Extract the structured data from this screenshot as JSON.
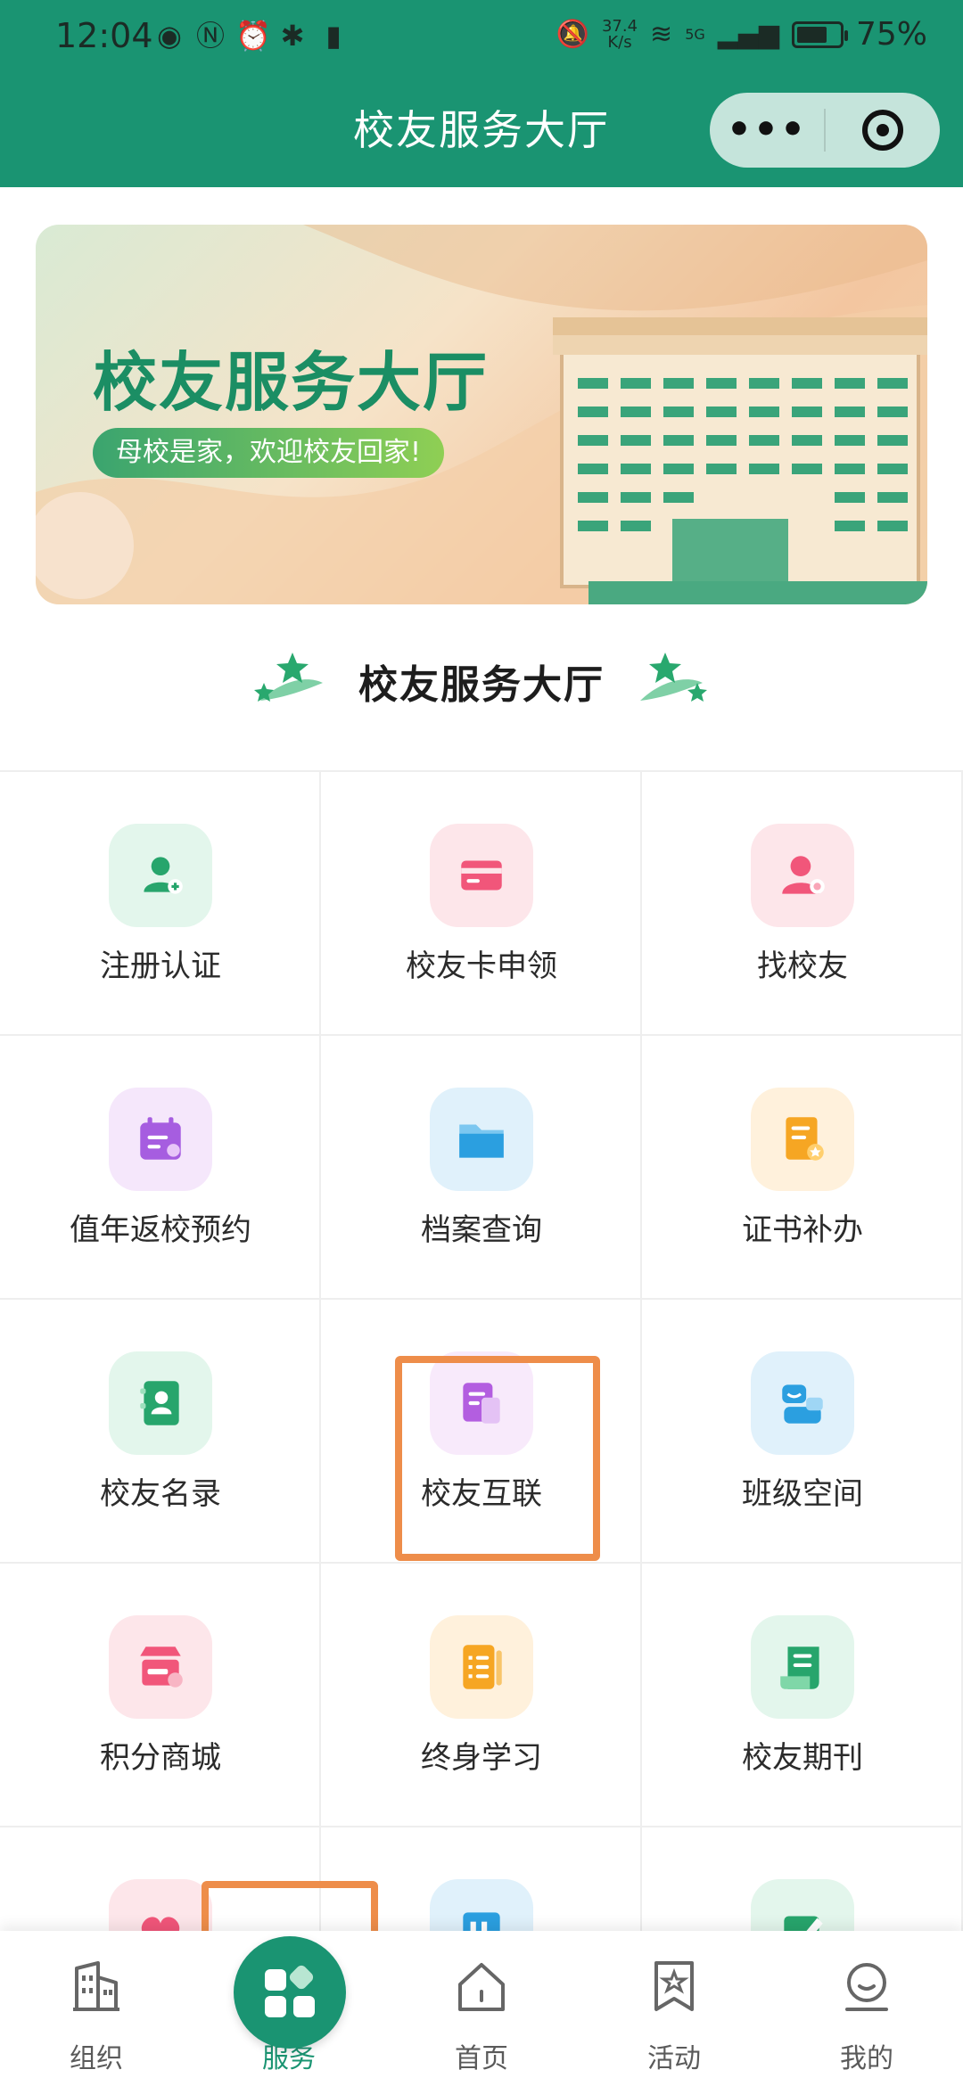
{
  "status_bar": {
    "time": "12:04",
    "net_speed_value": "37.4",
    "net_speed_unit": "K/s",
    "network": "5G",
    "battery_percent": "75%",
    "battery_level": 0.75
  },
  "nav": {
    "title": "校友服务大厅",
    "more_label": "•••"
  },
  "banner": {
    "title": "校友服务大厅",
    "slogan": "母校是家，欢迎校友回家!"
  },
  "section": {
    "title": "校友服务大厅"
  },
  "services": [
    {
      "label": "注册认证",
      "icon": "user-add-icon",
      "bg": "#e3f6ec",
      "color": "#27a56c"
    },
    {
      "label": "校友卡申领",
      "icon": "card-icon",
      "bg": "#fde6ea",
      "color": "#f1567a"
    },
    {
      "label": "找校友",
      "icon": "user-search-icon",
      "bg": "#fde6ea",
      "color": "#f1567a"
    },
    {
      "label": "值年返校预约",
      "icon": "calendar-icon",
      "bg": "#f5e7fb",
      "color": "#a65de0"
    },
    {
      "label": "档案查询",
      "icon": "folder-icon",
      "bg": "#e0f1fb",
      "color": "#2b9fe0"
    },
    {
      "label": "证书补办",
      "icon": "certificate-icon",
      "bg": "#fff1dc",
      "color": "#f6a623"
    },
    {
      "label": "校友名录",
      "icon": "contact-book-icon",
      "bg": "#e3f6ec",
      "color": "#27a56c"
    },
    {
      "label": "校友互联",
      "icon": "document-icon",
      "bg": "#f8eafb",
      "color": "#b35ee0"
    },
    {
      "label": "班级空间",
      "icon": "person-chat-icon",
      "bg": "#e0f1fb",
      "color": "#2b9fe0"
    },
    {
      "label": "积分商城",
      "icon": "shop-icon",
      "bg": "#fde6ea",
      "color": "#f1567a"
    },
    {
      "label": "终身学习",
      "icon": "notebook-icon",
      "bg": "#fff1dc",
      "color": "#f6a623"
    },
    {
      "label": "校友期刊",
      "icon": "journal-icon",
      "bg": "#e3f6ec",
      "color": "#27a56c"
    },
    {
      "label": "",
      "icon": "heart-icon",
      "bg": "#fde6ea",
      "color": "#f1567a"
    },
    {
      "label": "",
      "icon": "chart-icon",
      "bg": "#e0f1fb",
      "color": "#2b9fe0"
    },
    {
      "label": "",
      "icon": "edit-icon",
      "bg": "#e3f6ec",
      "color": "#27a56c"
    }
  ],
  "tabbar": {
    "items": [
      {
        "label": "组织",
        "icon": "building-icon"
      },
      {
        "label": "服务",
        "icon": "grid-icon",
        "active": true
      },
      {
        "label": "首页",
        "icon": "home-icon"
      },
      {
        "label": "活动",
        "icon": "badge-icon"
      },
      {
        "label": "我的",
        "icon": "profile-icon"
      }
    ]
  },
  "colors": {
    "brand": "#1a9472",
    "highlight": "#ee8d4a"
  }
}
